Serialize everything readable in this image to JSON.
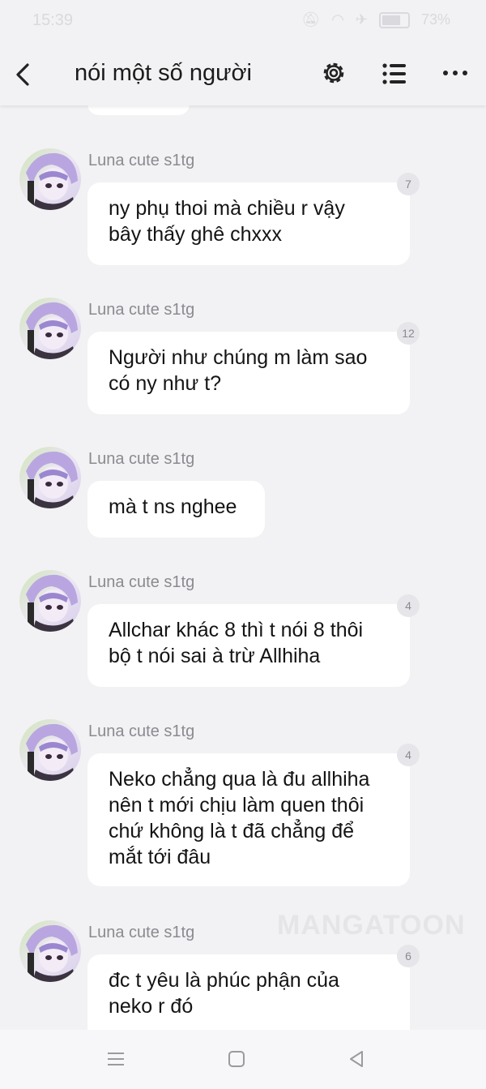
{
  "status_bar": {
    "time": "15:39",
    "battery": "73%"
  },
  "header": {
    "title": "nói một số người"
  },
  "icons": {
    "back": "back-arrow-icon",
    "settings": "gear-icon",
    "list": "list-icon",
    "more": "more-icon"
  },
  "messages": [
    {
      "sender": "Luna cute s1tg",
      "lines": [
        "ny phụ thoi mà chiều r vậy",
        "bây thấy ghê chxxx"
      ],
      "count": "7"
    },
    {
      "sender": "Luna cute s1tg",
      "lines": [
        "Người như chúng m làm sao",
        "có ny như t?"
      ],
      "count": "12"
    },
    {
      "sender": "Luna cute s1tg",
      "lines": [
        "mà t ns nghee"
      ],
      "count": ""
    },
    {
      "sender": "Luna cute s1tg",
      "lines": [
        "Allchar khác 8 thì t nói 8 thôi",
        "bộ t nói sai à trừ Allhiha"
      ],
      "count": "4"
    },
    {
      "sender": "Luna cute s1tg",
      "lines": [
        "Neko chẳng qua là đu allhiha",
        "nên t mới chịu làm quen thôi",
        "chứ không là t đã chẳng để",
        "mắt tới đâu"
      ],
      "count": "4"
    },
    {
      "sender": "Luna cute s1tg",
      "lines": [
        "đc t yêu là phúc phận của",
        "neko r đó"
      ],
      "count": "6"
    }
  ],
  "watermark": "MANGATOON"
}
